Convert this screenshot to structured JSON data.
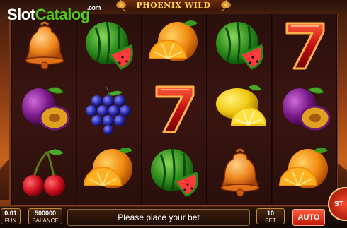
{
  "watermark": {
    "slot": "Slot",
    "catalog": "Catalog",
    "dotcom": ".com"
  },
  "game_title": "PHOENIX WILD",
  "reels": [
    [
      "bell",
      "plum",
      "cherries"
    ],
    [
      "watermelon",
      "grapes",
      "orange"
    ],
    [
      "orange",
      "seven",
      "watermelon"
    ],
    [
      "watermelon",
      "lemon",
      "bell"
    ],
    [
      "seven",
      "plum",
      "orange"
    ]
  ],
  "bottom_bar": {
    "denomination": {
      "value": "0.01",
      "label": "FUN"
    },
    "balance": {
      "value": "500000",
      "label": "BALANCE"
    },
    "message": "Please place your bet",
    "bet": {
      "value": "10",
      "label": "BET"
    },
    "auto_label": "AUTO",
    "spin_label": "ST"
  },
  "colors": {
    "catalog_green": "#57c91a",
    "title_gold": "#ffd35a",
    "auto_red": "#e0321a",
    "panel_border": "#c08a3a"
  }
}
